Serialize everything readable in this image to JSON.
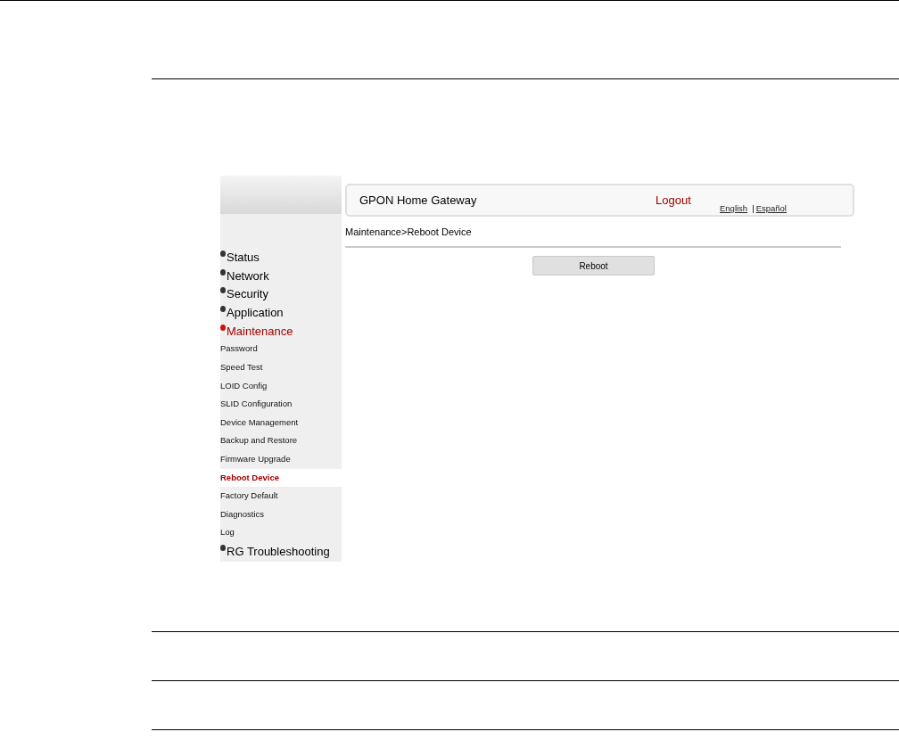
{
  "header": {
    "title": "GPON Home Gateway",
    "logout": "Logout",
    "languages": [
      {
        "label": "English"
      },
      {
        "label": "Español"
      }
    ],
    "separator": "|"
  },
  "sidebar": {
    "items": [
      {
        "label": "Status",
        "expanded": false
      },
      {
        "label": "Network",
        "expanded": false
      },
      {
        "label": "Security",
        "expanded": false
      },
      {
        "label": "Application",
        "expanded": false
      },
      {
        "label": "Maintenance",
        "expanded": true,
        "children": [
          {
            "label": "Password",
            "selected": false
          },
          {
            "label": "Speed Test",
            "selected": false
          },
          {
            "label": "LOID Config",
            "selected": false
          },
          {
            "label": "SLID Configuration",
            "selected": false
          },
          {
            "label": "Device Management",
            "selected": false
          },
          {
            "label": "Backup and Restore",
            "selected": false
          },
          {
            "label": "Firmware Upgrade",
            "selected": false
          },
          {
            "label": "Reboot Device",
            "selected": true
          },
          {
            "label": "Factory Default",
            "selected": false
          },
          {
            "label": "Diagnostics",
            "selected": false
          },
          {
            "label": "Log",
            "selected": false
          }
        ]
      },
      {
        "label": "RG Troubleshooting",
        "expanded": false
      }
    ]
  },
  "breadcrumb": "Maintenance>Reboot Device",
  "buttons": [
    "Reboot"
  ]
}
